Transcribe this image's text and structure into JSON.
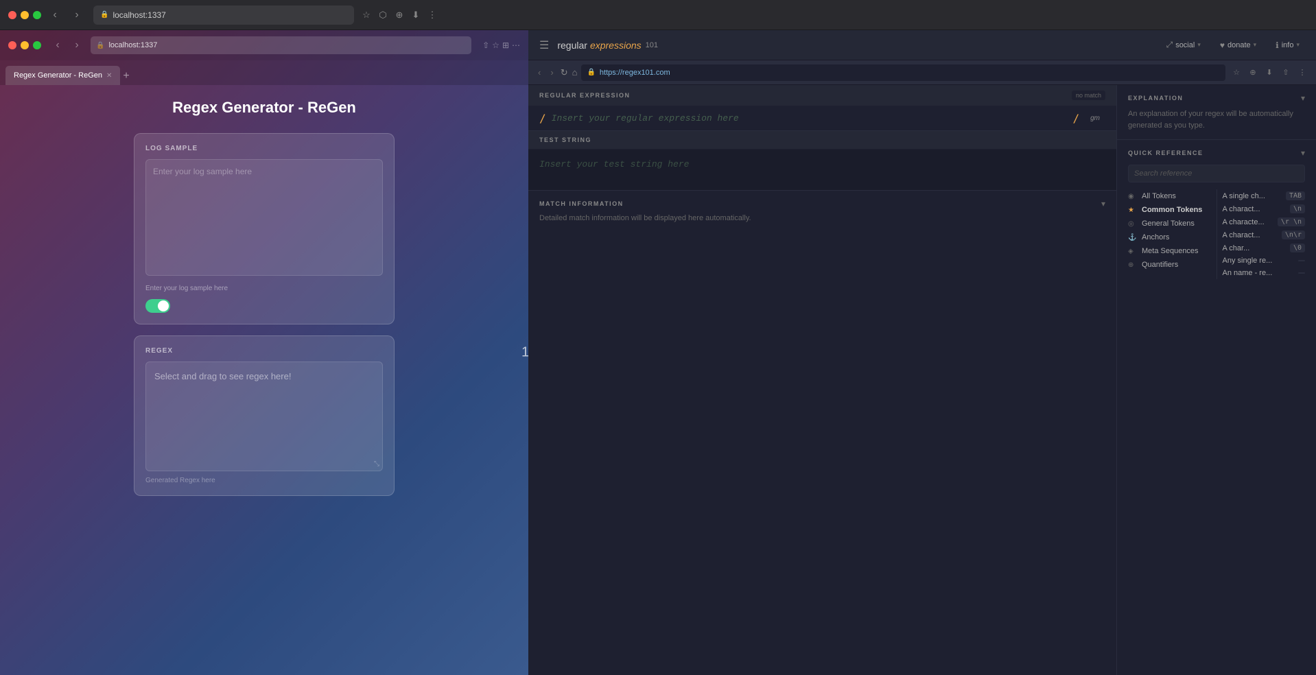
{
  "browser": {
    "traffic_lights": [
      "red",
      "yellow",
      "green"
    ],
    "left_tab": {
      "title": "localhost:1337",
      "url": "localhost:1337"
    },
    "right_tab": {
      "title": "https://regex101.com",
      "url": "https://regex101.com"
    },
    "add_tab_label": "+",
    "nav_back": "‹",
    "nav_forward": "›",
    "nav_refresh": "↻",
    "nav_home": "⌂"
  },
  "regen": {
    "title": "Regex Generator - ReGen",
    "log_sample_label": "LOG SAMPLE",
    "log_textarea_placeholder": "Enter your log sample here",
    "log_hint": "Enter your log sample here",
    "toggle_state": true,
    "regex_label": "REGEX",
    "regex_placeholder": "Select and drag to see regex here!",
    "regex_footer": "Generated Regex here"
  },
  "divider_number": "1",
  "regex101": {
    "header": {
      "menu_icon": "☰",
      "logo_regular": "regular",
      "logo_expressions": "expressions",
      "logo_101": "101",
      "social_btn": "social",
      "donate_btn": "donate",
      "info_btn": "info"
    },
    "address_bar": {
      "url": "https://regex101.com",
      "lock_icon": "🔒"
    },
    "regex_section": {
      "label": "REGULAR EXPRESSION",
      "no_match": "no match",
      "slash_open": "/",
      "placeholder": "Insert your regular expression here",
      "slash_close": "/",
      "flags": "gm"
    },
    "test_string_section": {
      "label": "TEST STRING",
      "placeholder": "Insert your test string here"
    },
    "explanation_section": {
      "label": "EXPLANATION",
      "text": "An explanation of your regex will be automatically\ngenerated as you type."
    },
    "match_info_section": {
      "label": "MATCH INFORMATION",
      "text": "Detailed match information will be displayed here\nautomatically."
    },
    "quick_ref": {
      "label": "QUICK REFERENCE",
      "search_placeholder": "Search reference",
      "left_items": [
        {
          "icon": "◉",
          "label": "All Tokens",
          "bold": false
        },
        {
          "icon": "★",
          "label": "Common Tokens",
          "bold": true
        },
        {
          "icon": "◎",
          "label": "General Tokens",
          "bold": false
        },
        {
          "icon": "⚓",
          "label": "Anchors",
          "bold": false
        },
        {
          "icon": "◈",
          "label": "Meta Sequences",
          "bold": false
        },
        {
          "icon": "⊕",
          "label": "Quantifiers",
          "bold": false
        }
      ],
      "right_items": [
        {
          "text": "A single ch...",
          "badge": "TAB↹"
        },
        {
          "text": "A charact...",
          "badge": "↵↵↵↵"
        },
        {
          "text": "A characte...",
          "badge": "↵ ↵ ↵"
        },
        {
          "text": "A charact...",
          "badge": "↵↵ ↵↵"
        },
        {
          "text": "A char...↵↵↵↵",
          "badge": "↵↵↵↵"
        },
        {
          "text": "Any single re...",
          "badge": ""
        },
        {
          "text": "An name - re...",
          "badge": ""
        }
      ]
    }
  }
}
